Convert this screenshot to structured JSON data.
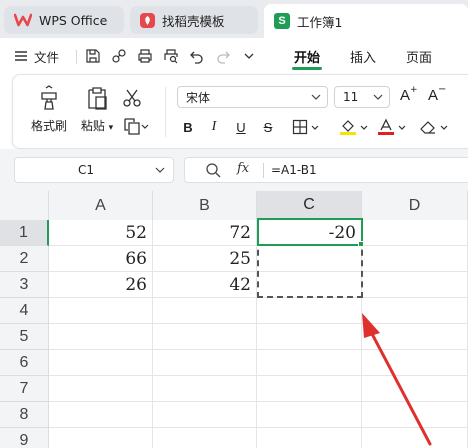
{
  "tabs": [
    {
      "label": "WPS Office"
    },
    {
      "label": "找稻壳模板"
    },
    {
      "label": "工作簿1"
    }
  ],
  "menu": {
    "file_label": "文件",
    "tabs": [
      {
        "label": "开始",
        "active": true
      },
      {
        "label": "插入"
      },
      {
        "label": "页面"
      }
    ]
  },
  "ribbon": {
    "format_painter": "格式刷",
    "paste": "粘贴",
    "font_name": "宋体",
    "font_size": "11",
    "bold": "B",
    "italic": "I",
    "underline": "U",
    "strikethrough": "S",
    "grow_font": "A",
    "shrink_font": "A"
  },
  "formula_bar": {
    "cell_ref": "C1",
    "fx": "fx",
    "formula": "=A1-B1"
  },
  "sheet": {
    "columns": [
      "A",
      "B",
      "C",
      "D"
    ],
    "rows": [
      "1",
      "2",
      "3",
      "4",
      "5",
      "6",
      "7",
      "8",
      "9"
    ],
    "cells": [
      [
        "52",
        "72",
        "-20",
        ""
      ],
      [
        "66",
        "25",
        "",
        ""
      ],
      [
        "26",
        "42",
        "",
        ""
      ]
    ],
    "active_cell": "C1"
  },
  "colors": {
    "accent": "#1f9d55",
    "annotation_arrow": "#e0302e",
    "font_color_bar": "#e02020",
    "highlight_bar": "#f5e400"
  }
}
